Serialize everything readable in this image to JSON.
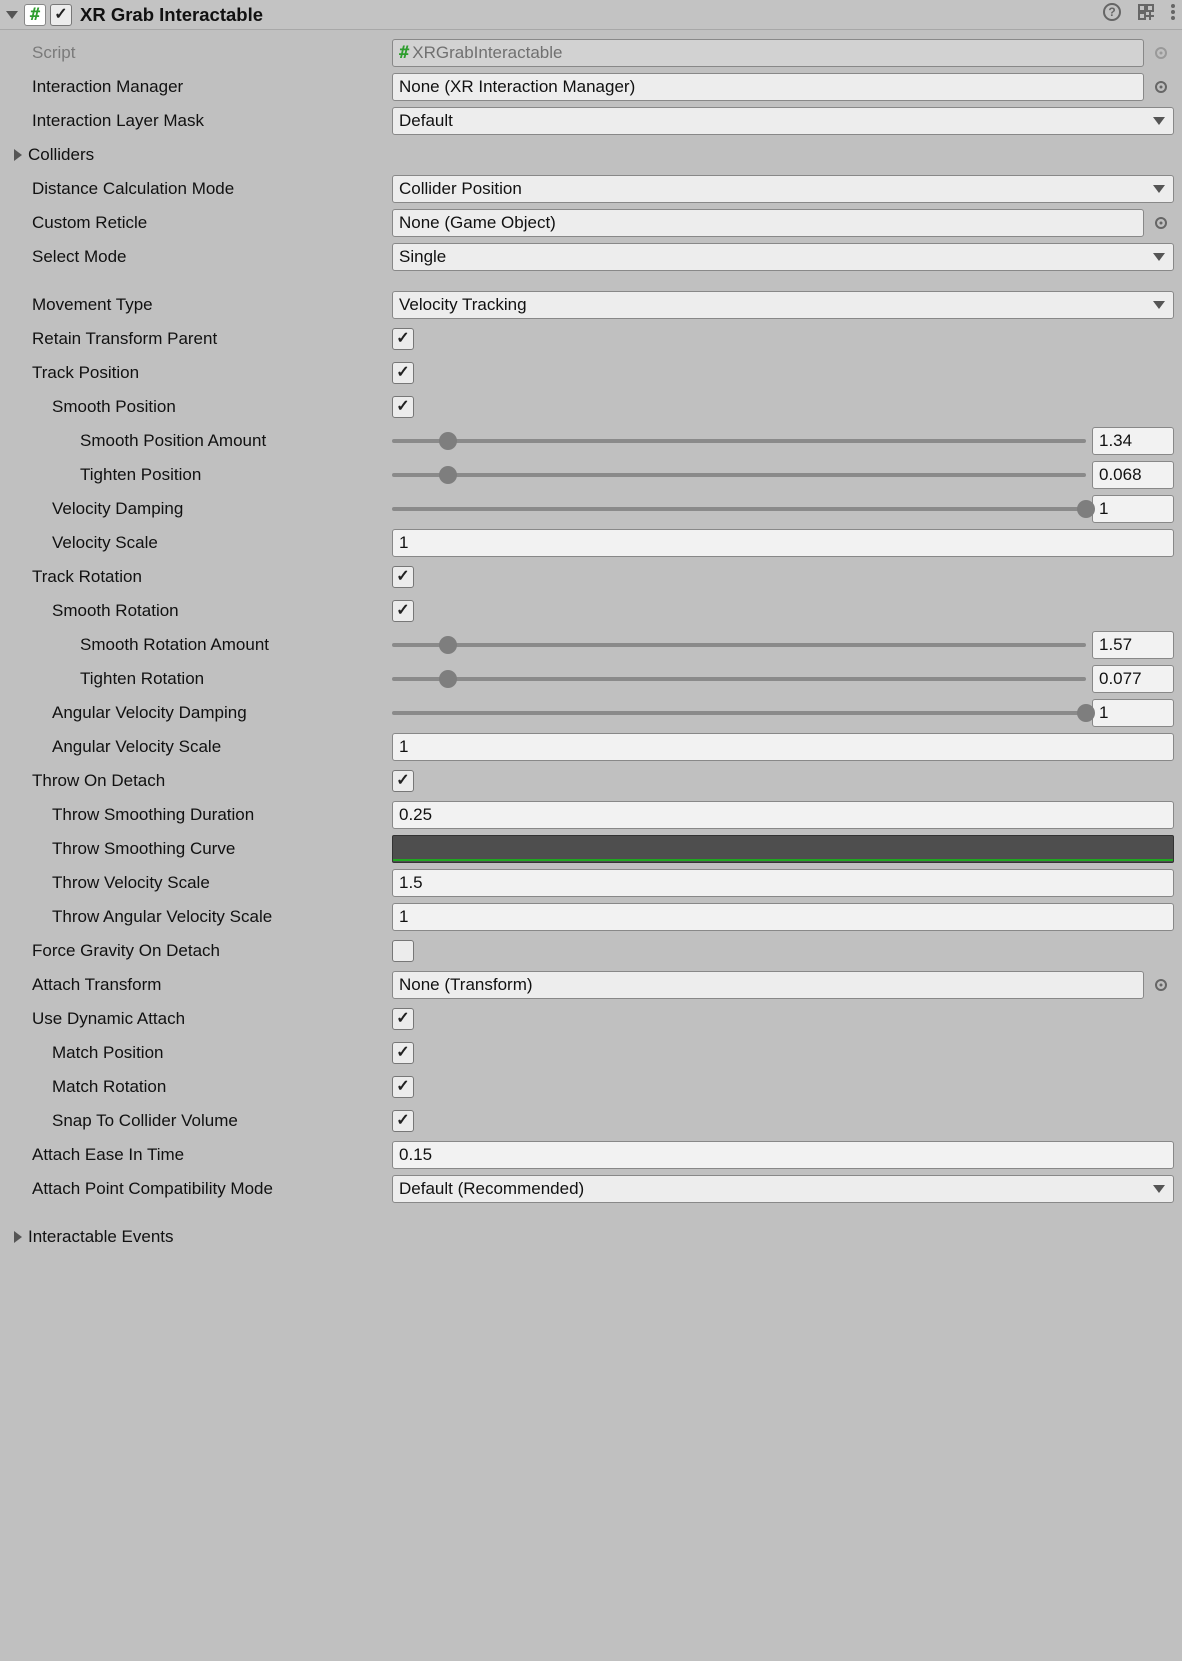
{
  "header": {
    "title": "XR Grab Interactable",
    "enabled": true
  },
  "fields": {
    "script": {
      "label": "Script",
      "value": "XRGrabInteractable"
    },
    "interactionManager": {
      "label": "Interaction Manager",
      "value": "None (XR Interaction Manager)"
    },
    "interactionLayerMask": {
      "label": "Interaction Layer Mask",
      "value": "Default"
    },
    "colliders": {
      "label": "Colliders"
    },
    "distanceCalcMode": {
      "label": "Distance Calculation Mode",
      "value": "Collider Position"
    },
    "customReticle": {
      "label": "Custom Reticle",
      "value": "None (Game Object)"
    },
    "selectMode": {
      "label": "Select Mode",
      "value": "Single"
    },
    "movementType": {
      "label": "Movement Type",
      "value": "Velocity Tracking"
    },
    "retainTransformParent": {
      "label": "Retain Transform Parent",
      "checked": true
    },
    "trackPosition": {
      "label": "Track Position",
      "checked": true
    },
    "smoothPosition": {
      "label": "Smooth Position",
      "checked": true
    },
    "smoothPositionAmount": {
      "label": "Smooth Position Amount",
      "value": "1.34",
      "pct": 8
    },
    "tightenPosition": {
      "label": "Tighten Position",
      "value": "0.068",
      "pct": 8
    },
    "velocityDamping": {
      "label": "Velocity Damping",
      "value": "1",
      "pct": 100
    },
    "velocityScale": {
      "label": "Velocity Scale",
      "value": "1"
    },
    "trackRotation": {
      "label": "Track Rotation",
      "checked": true
    },
    "smoothRotation": {
      "label": "Smooth Rotation",
      "checked": true
    },
    "smoothRotationAmount": {
      "label": "Smooth Rotation Amount",
      "value": "1.57",
      "pct": 8
    },
    "tightenRotation": {
      "label": "Tighten Rotation",
      "value": "0.077",
      "pct": 8
    },
    "angularVelocityDamping": {
      "label": "Angular Velocity Damping",
      "value": "1",
      "pct": 100
    },
    "angularVelocityScale": {
      "label": "Angular Velocity Scale",
      "value": "1"
    },
    "throwOnDetach": {
      "label": "Throw On Detach",
      "checked": true
    },
    "throwSmoothingDuration": {
      "label": "Throw Smoothing Duration",
      "value": "0.25"
    },
    "throwSmoothingCurve": {
      "label": "Throw Smoothing Curve"
    },
    "throwVelocityScale": {
      "label": "Throw Velocity Scale",
      "value": "1.5"
    },
    "throwAngularVelocityScale": {
      "label": "Throw Angular Velocity Scale",
      "value": "1"
    },
    "forceGravityOnDetach": {
      "label": "Force Gravity On Detach",
      "checked": false
    },
    "attachTransform": {
      "label": "Attach Transform",
      "value": "None (Transform)"
    },
    "useDynamicAttach": {
      "label": "Use Dynamic Attach",
      "checked": true
    },
    "matchPosition": {
      "label": "Match Position",
      "checked": true
    },
    "matchRotation": {
      "label": "Match Rotation",
      "checked": true
    },
    "snapToColliderVolume": {
      "label": "Snap To Collider Volume",
      "checked": true
    },
    "attachEaseInTime": {
      "label": "Attach Ease In Time",
      "value": "0.15"
    },
    "attachPointCompat": {
      "label": "Attach Point Compatibility Mode",
      "value": "Default (Recommended)"
    },
    "interactableEvents": {
      "label": "Interactable Events"
    }
  }
}
